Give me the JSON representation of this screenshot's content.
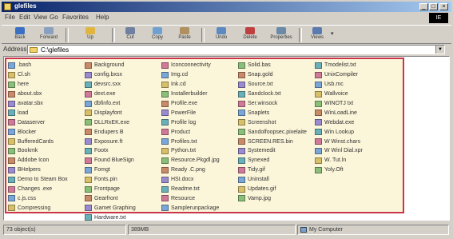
{
  "window": {
    "title": "glefiles",
    "colors": {
      "title_start": "#0a246a",
      "title_end": "#a6caf0",
      "highlight": "#c9364a",
      "panel": "#fbf5d9"
    }
  },
  "menu": [
    "File",
    "Edit",
    "View",
    "Go",
    "Favorites",
    "Help"
  ],
  "toolbar": [
    {
      "label": "Back",
      "icon": "back-arrow-icon",
      "color": "#3a6fc4"
    },
    {
      "label": "Forward",
      "icon": "forward-arrow-icon",
      "color": "#8aa0c0"
    },
    {
      "label": "Up",
      "icon": "up-folder-icon",
      "color": "#e0b640"
    },
    {
      "label": "Cut",
      "icon": "scissors-icon",
      "color": "#7080a0"
    },
    {
      "label": "Copy",
      "icon": "copy-icon",
      "color": "#6fa0d0"
    },
    {
      "label": "Paste",
      "icon": "paste-icon",
      "color": "#b09060"
    },
    {
      "label": "Undo",
      "icon": "undo-icon",
      "color": "#5c8ac0"
    },
    {
      "label": "Delete",
      "icon": "delete-icon",
      "color": "#c04040"
    },
    {
      "label": "Properties",
      "icon": "properties-icon",
      "color": "#6a8aa8"
    },
    {
      "label": "Views",
      "icon": "views-icon",
      "color": "#5a7ab0"
    }
  ],
  "address": {
    "label": "Address",
    "path": "C:\\glefiles"
  },
  "columns": [
    [
      ".bash",
      "Cl.sh",
      "here",
      "about.sbx",
      "avatar.sbx",
      "load",
      "Dataserver",
      "Blocker",
      "BufferedCards",
      "Bookmk",
      "Addobe Icon",
      "BHelpers",
      "Demo to Steam Box",
      "Changes .exe",
      "c.js.css",
      "Compressing"
    ],
    [
      "Background",
      "config.bxsx",
      "devsrc.sxx",
      "dext.exe",
      "dbfinfo.ext",
      "Displayfont",
      "DLLRxEK.exe",
      "Endupers B",
      "Exposure.ft",
      "Footx",
      "Found BlueSign",
      "Fomgt",
      "Fonts.pin",
      "Frontpage",
      "Gearfront",
      "Gamet Graphing",
      "Hardware.txt"
    ],
    [
      "Iconconnectivity",
      "Img.cd",
      "Ink.cd",
      "Installerbuilder",
      "Profile.exe",
      "PowerFile",
      "Profile log",
      "Product",
      "Profiles.txt",
      "Python.txt",
      "Resource.Pkgdl.jpg",
      "Ready .C.png",
      "HSI.docx",
      "Readme.txt",
      "Resource",
      "Samplerunpackage"
    ],
    [
      "Solid.bas",
      "Snap.gold",
      "Source.txt",
      "Sandclock.txt",
      "Ser.winsock",
      "Snaplets",
      "Screenshot",
      "Sandolfoopsec.pixelaite",
      "SCREEN.RES.bin",
      "Systemedit",
      "Synexed",
      "Tidy.gif",
      "Uninstall",
      "Updates.gif",
      "Vamp.jpg"
    ],
    [
      "Tmodelist.txt",
      "UnixCompiler",
      "Usb.mc",
      "Wallvoice",
      "WINOTJ txt",
      "WinLoadLine",
      "Webdat.exe",
      "Win Lookup",
      "W Winst.chars",
      "W Winl Dial.xpr",
      "W. Tut.ln",
      "Yoly.Oft"
    ]
  ],
  "status": {
    "objects": "73 object(s)",
    "size": "389MB",
    "zone": "My Computer"
  }
}
